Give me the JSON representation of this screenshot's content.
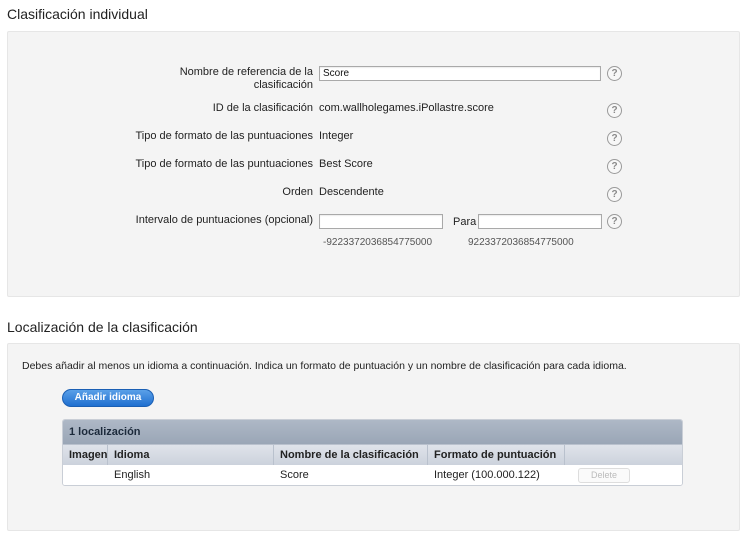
{
  "section1": {
    "title": "Clasificación individual",
    "fields": {
      "ref_name": {
        "label": "Nombre de referencia de la clasificación",
        "value": "Score"
      },
      "id": {
        "label": "ID de la clasificación",
        "value": "com.wallholegames.iPollastre.score"
      },
      "format_type": {
        "label": "Tipo de formato de las puntuaciones",
        "value": "Integer"
      },
      "format_type2": {
        "label": "Tipo de formato de las puntuaciones",
        "value": "Best Score"
      },
      "order": {
        "label": "Orden",
        "value": "Descendente"
      },
      "range": {
        "label": "Intervalo de puntuaciones (opcional)",
        "min_value": "",
        "max_value": "",
        "para_label": "Para",
        "min_hint": "-9223372036854775000",
        "max_hint": "9223372036854775000"
      }
    },
    "help_icon_glyph": "?"
  },
  "section2": {
    "title": "Localización de la clasificación",
    "description": "Debes añadir al menos un idioma a continuación. Indica un formato de puntuación y un nombre de clasificación para cada idioma.",
    "add_button": "Añadir idioma",
    "table": {
      "caption": "1 localización",
      "columns": [
        "Imagen",
        "Idioma",
        "Nombre de la clasificación",
        "Formato de puntuación",
        ""
      ],
      "rows": [
        {
          "image": "",
          "language": "English",
          "name": "Score",
          "format": "Integer (100.000.122)",
          "action": "Delete"
        }
      ]
    }
  }
}
